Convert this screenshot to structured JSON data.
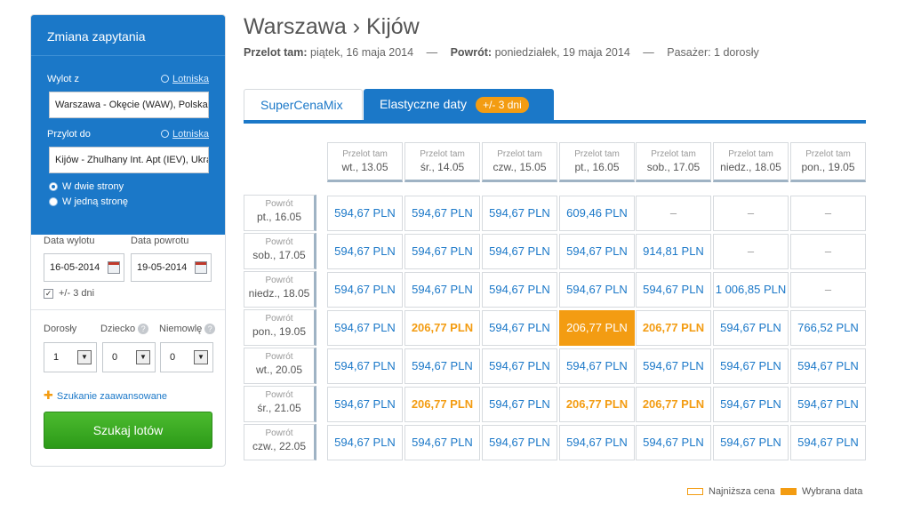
{
  "sidebar": {
    "title": "Zmiana zapytania",
    "from_label": "Wylot z",
    "from_link": "Lotniska",
    "from_value": "Warszawa - Okęcie (WAW), Polska",
    "to_label": "Przylot do",
    "to_link": "Lotniska",
    "to_value": "Kijów - Zhulhany Int. Apt (IEV), Ukraina",
    "radio_round": "W dwie strony",
    "radio_oneway": "W jedną stronę",
    "dep_date_label": "Data wylotu",
    "ret_date_label": "Data powrotu",
    "dep_date": "16-05-2014",
    "ret_date": "19-05-2014",
    "flex_label": "+/- 3 dni",
    "adults_label": "Dorosły",
    "child_label": "Dziecko",
    "infant_label": "Niemowlę",
    "adults": "1",
    "children": "0",
    "infants": "0",
    "advanced": "Szukanie zaawansowane",
    "search_button": "Szukaj lotów"
  },
  "header": {
    "route": "Warszawa › Kijów",
    "out_label": "Przelot tam:",
    "out_value": "piątek, 16 maja 2014",
    "ret_label": "Powrót:",
    "ret_value": "poniedziałek, 19 maja 2014",
    "pax": "Pasażer: 1 dorosły",
    "dash": "—"
  },
  "tabs": {
    "tab1": "SuperCenaMix",
    "tab2": "Elastyczne daty",
    "badge": "+/- 3 dni"
  },
  "grid": {
    "col_prefix": "Przelot tam",
    "row_prefix": "Powrót",
    "columns": [
      "wt., 13.05",
      "śr., 14.05",
      "czw., 15.05",
      "pt., 16.05",
      "sob., 17.05",
      "niedz., 18.05",
      "pon., 19.05"
    ],
    "rows": [
      {
        "label": "pt., 16.05",
        "cells": [
          "594,67 PLN",
          "594,67 PLN",
          "594,67 PLN",
          "609,46 PLN",
          "–",
          "–",
          "–"
        ]
      },
      {
        "label": "sob., 17.05",
        "cells": [
          "594,67 PLN",
          "594,67 PLN",
          "594,67 PLN",
          "594,67 PLN",
          "914,81 PLN",
          "–",
          "–"
        ]
      },
      {
        "label": "niedz., 18.05",
        "cells": [
          "594,67 PLN",
          "594,67 PLN",
          "594,67 PLN",
          "594,67 PLN",
          "594,67 PLN",
          "1 006,85 PLN",
          "–"
        ]
      },
      {
        "label": "pon., 19.05",
        "cells": [
          "594,67 PLN",
          "206,77 PLN",
          "594,67 PLN",
          "206,77 PLN",
          "206,77 PLN",
          "594,67 PLN",
          "766,52 PLN"
        ]
      },
      {
        "label": "wt., 20.05",
        "cells": [
          "594,67 PLN",
          "594,67 PLN",
          "594,67 PLN",
          "594,67 PLN",
          "594,67 PLN",
          "594,67 PLN",
          "594,67 PLN"
        ]
      },
      {
        "label": "śr., 21.05",
        "cells": [
          "594,67 PLN",
          "206,77 PLN",
          "594,67 PLN",
          "206,77 PLN",
          "206,77 PLN",
          "594,67 PLN",
          "594,67 PLN"
        ]
      },
      {
        "label": "czw., 22.05",
        "cells": [
          "594,67 PLN",
          "594,67 PLN",
          "594,67 PLN",
          "594,67 PLN",
          "594,67 PLN",
          "594,67 PLN",
          "594,67 PLN"
        ]
      }
    ],
    "cheapest_cells": [
      [
        3,
        1
      ],
      [
        3,
        4
      ],
      [
        5,
        1
      ],
      [
        5,
        3
      ],
      [
        5,
        4
      ]
    ],
    "selected_cell": [
      3,
      3
    ]
  },
  "legend": {
    "cheapest": "Najniższa cena",
    "selected": "Wybrana data"
  },
  "colors": {
    "accent": "#1b78c8",
    "highlight": "#f39c12",
    "button": "#3aa823"
  }
}
